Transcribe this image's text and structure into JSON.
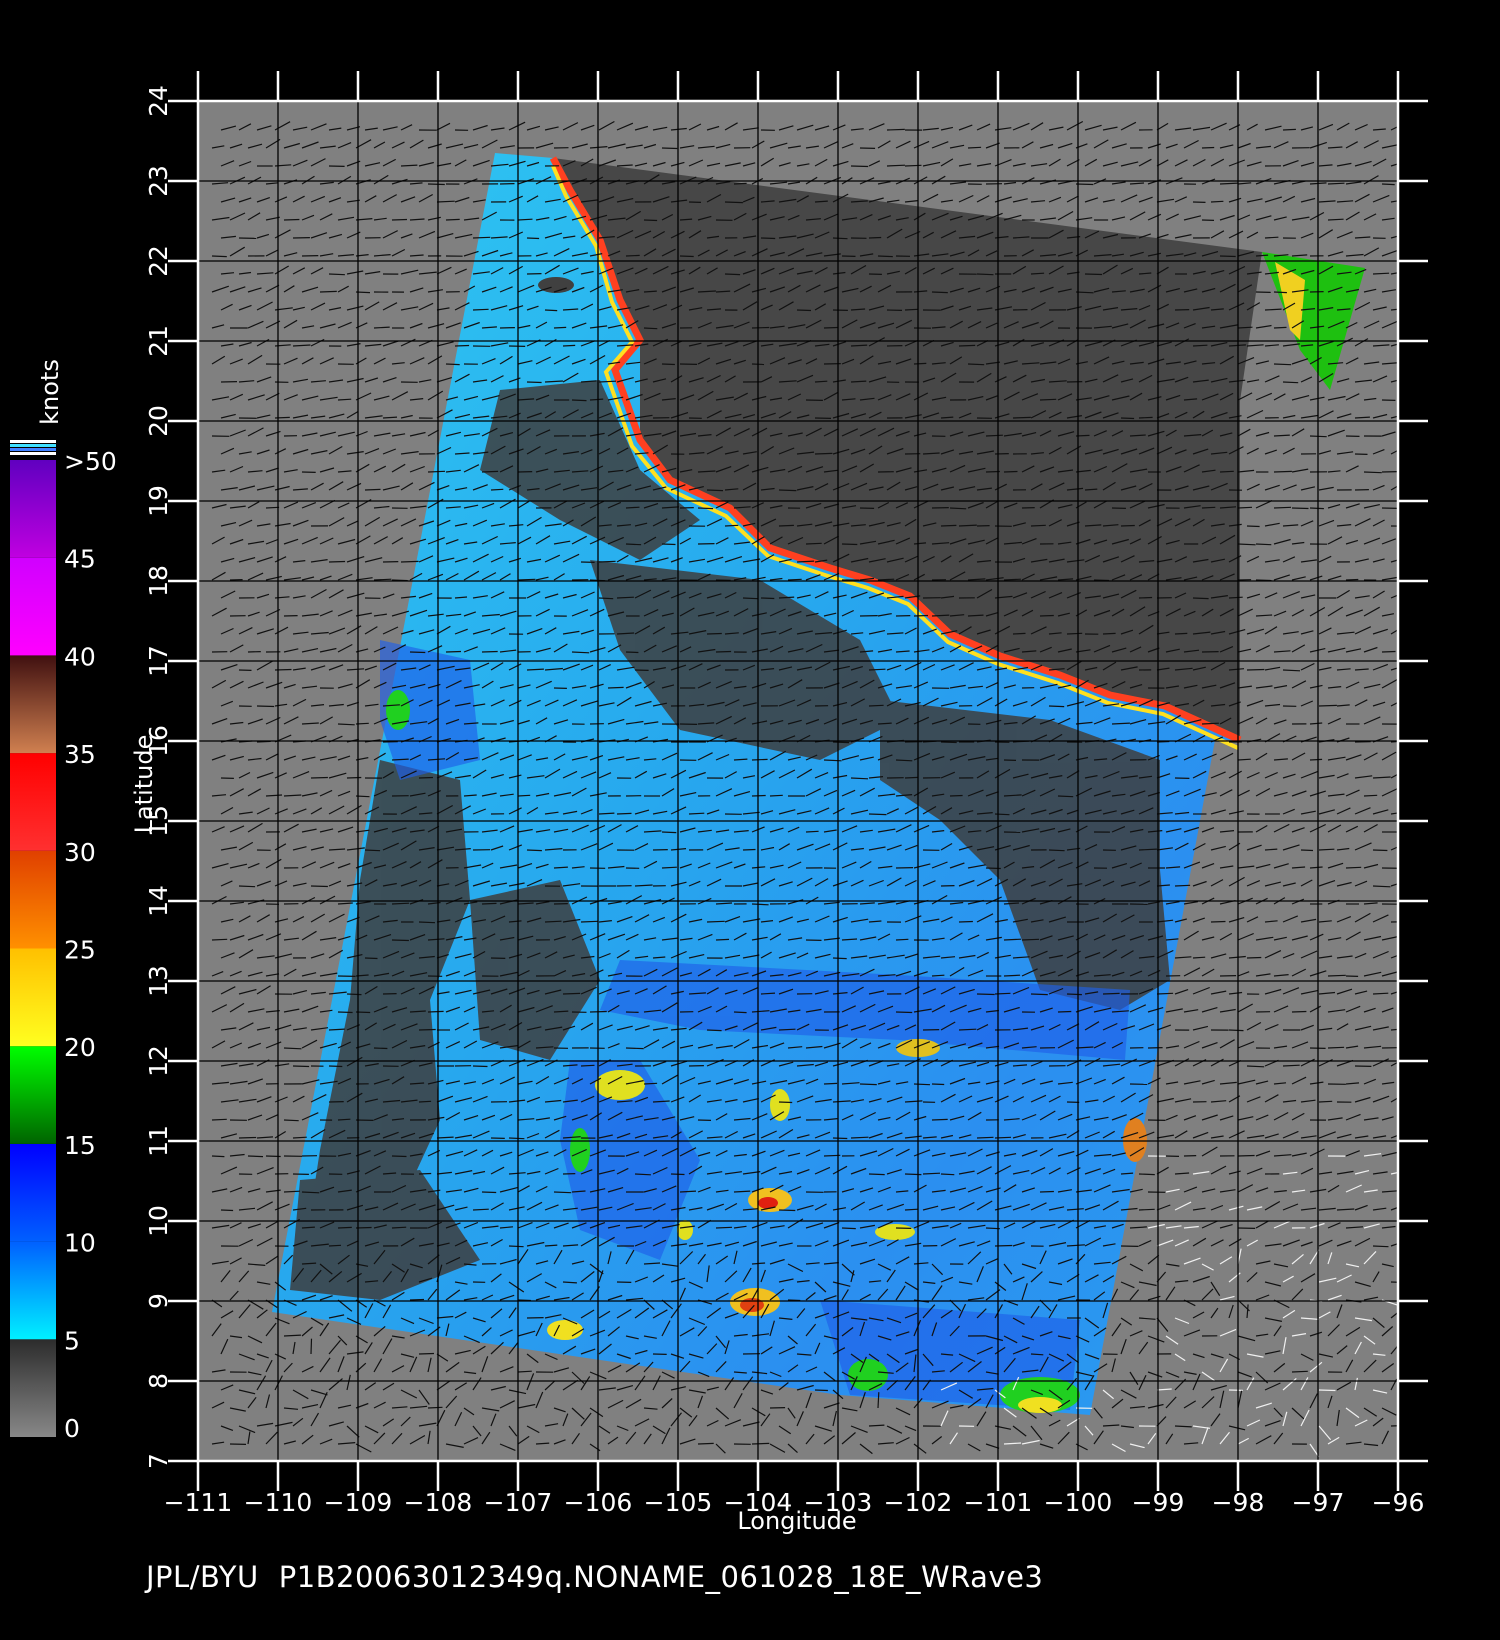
{
  "map": {
    "x_axis_label": "Longitude",
    "y_axis_label": "Latitude",
    "longitude_ticks": [
      -111,
      -110,
      -109,
      -108,
      -107,
      -106,
      -105,
      -104,
      -103,
      -102,
      -101,
      -100,
      -99,
      -98,
      -97,
      -96
    ],
    "latitude_ticks": [
      7,
      8,
      9,
      10,
      11,
      12,
      13,
      14,
      15,
      16,
      17,
      18,
      19,
      20,
      21,
      22,
      23,
      24
    ],
    "longitude_range": [
      -111,
      -96
    ],
    "latitude_range": [
      7,
      24
    ],
    "background_color": "#808080",
    "land_color": "#474747",
    "grid": true
  },
  "colorbar": {
    "unit": "knots",
    "labels": [
      "0",
      "5",
      "10",
      "15",
      "20",
      "25",
      "30",
      "35",
      "40",
      "45",
      ">50"
    ],
    "bands": [
      {
        "from": 0,
        "to": 5,
        "color_bottom": "#888888",
        "color_top": "#2c2c2c"
      },
      {
        "from": 5,
        "to": 10,
        "color_bottom": "#00f0ff",
        "color_top": "#0060ff"
      },
      {
        "from": 10,
        "to": 15,
        "color_bottom": "#0060ff",
        "color_top": "#0000ff"
      },
      {
        "from": 15,
        "to": 20,
        "color_bottom": "#006400",
        "color_top": "#00ff00"
      },
      {
        "from": 20,
        "to": 25,
        "color_bottom": "#ffff20",
        "color_top": "#ffc000"
      },
      {
        "from": 25,
        "to": 30,
        "color_bottom": "#ff9000",
        "color_top": "#e04000"
      },
      {
        "from": 30,
        "to": 35,
        "color_bottom": "#ff3030",
        "color_top": "#ff0000"
      },
      {
        "from": 35,
        "to": 40,
        "color_bottom": "#d08050",
        "color_top": "#401010"
      },
      {
        "from": 40,
        "to": 45,
        "color_bottom": "#ff00ff",
        "color_top": "#d000ff"
      },
      {
        "from": 45,
        "to": 50,
        "color_bottom": "#c000e0",
        "color_top": "#6000c0"
      }
    ]
  },
  "footer": {
    "source": "JPL/BYU",
    "filename": "P1B20063012349q.NONAME_061028_18E_WRave3"
  }
}
